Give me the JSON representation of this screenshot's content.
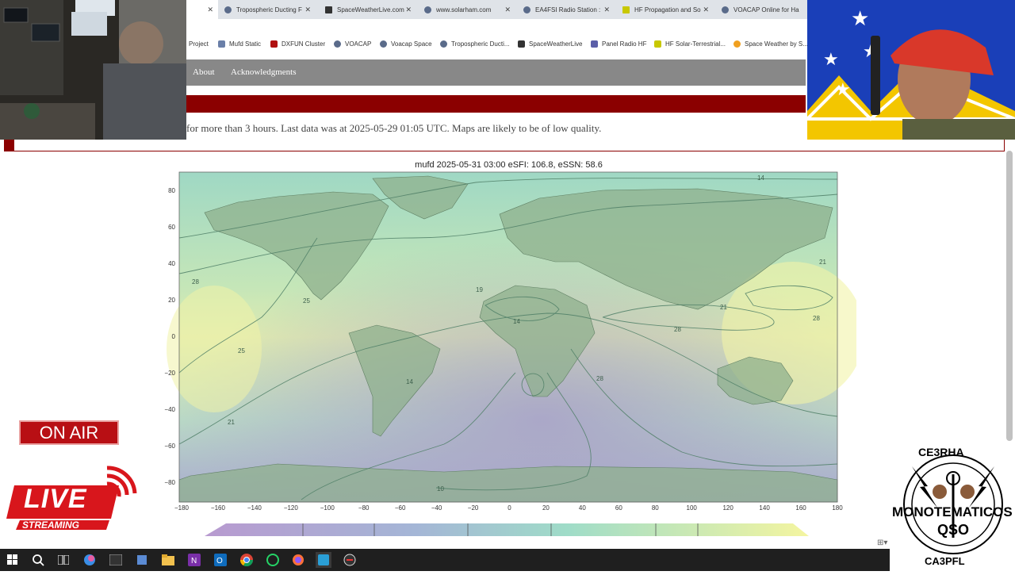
{
  "browser": {
    "tabs": [
      {
        "label": "",
        "active": true
      },
      {
        "label": "Tropospheric Ducting F"
      },
      {
        "label": "SpaceWeatherLive.com"
      },
      {
        "label": "www.solarham.com"
      },
      {
        "label": "EA4FSI Radio Station :"
      },
      {
        "label": "HF Propagation and So"
      },
      {
        "label": "VOACAP Online for Ha"
      }
    ],
    "bookmarks": [
      "Project",
      "Mufd Static",
      "DXFUN Cluster",
      "VOACAP",
      "Voacap Space",
      "Tropospheric Ducti...",
      "SpaceWeatherLive",
      "Panel Radio HF",
      "HF Solar-Terrestrial...",
      "Space Weather by S..."
    ]
  },
  "site": {
    "nav": [
      "About",
      "Acknowledgments"
    ],
    "warning": "for more than 3 hours. Last data was at 2025-05-29 01:05 UTC. Maps are likely to be of low quality."
  },
  "map": {
    "title": "mufd 2025-05-31 03:00 eSFI: 106.8, eSSN: 58.6",
    "x_ticks": [
      "−180",
      "−160",
      "−140",
      "−120",
      "−100",
      "−80",
      "−60",
      "−40",
      "−20",
      "0",
      "20",
      "40",
      "60",
      "80",
      "100",
      "120",
      "140",
      "160",
      "180"
    ],
    "y_ticks": [
      "80",
      "60",
      "40",
      "20",
      "0",
      "−20",
      "−40",
      "−60",
      "−80"
    ],
    "contour_labels": [
      "14",
      "21",
      "28",
      "25",
      "19",
      "14",
      "28",
      "21",
      "28",
      "25",
      "28",
      "14",
      "21",
      "10"
    ]
  },
  "overlays": {
    "on_air": "ON AIR",
    "live": "LIVE",
    "streaming": "STREAMING",
    "logo_top": "CE3RHA",
    "logo_mid1": "MONOTEMATICOS",
    "logo_mid2": "QSO",
    "logo_bottom": "CA3PFL"
  },
  "colors": {
    "nav_bg": "#888888",
    "red_bar": "#8b0000",
    "on_air": "#b80f14"
  }
}
